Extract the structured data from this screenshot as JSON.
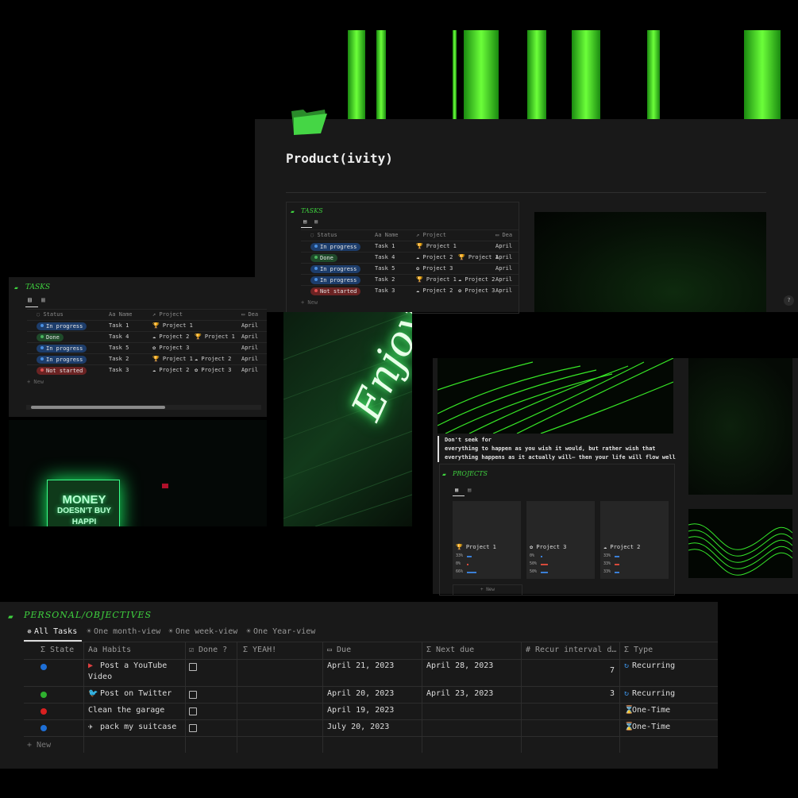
{
  "top_page": {
    "title": "Product(ivity)",
    "tasks_heading": "TASKS",
    "columns": [
      "Status",
      "Name",
      "Project",
      "Dea"
    ],
    "columns_prefix": [
      "◌",
      "Aa",
      "↗",
      "▭"
    ],
    "rows": [
      {
        "status": "In progress",
        "kind": "inprog",
        "name": "Task 1",
        "projects": [
          "🏆 Project 1"
        ],
        "date": "April"
      },
      {
        "status": "Done",
        "kind": "done",
        "name": "Task 4",
        "projects": [
          "☁ Project 2",
          "🏆 Project 1"
        ],
        "date": "April"
      },
      {
        "status": "In progress",
        "kind": "inprog",
        "name": "Task 5",
        "projects": [
          "✿ Project 3"
        ],
        "date": "April"
      },
      {
        "status": "In progress",
        "kind": "inprog",
        "name": "Task 2",
        "projects": [
          "🏆 Project 1",
          "☁ Project 2"
        ],
        "date": "April"
      },
      {
        "status": "Not started",
        "kind": "notstart",
        "name": "Task 3",
        "projects": [
          "☁ Project 2",
          "✿ Project 3"
        ],
        "date": "April"
      }
    ],
    "new_label": "+ New"
  },
  "left_page": {
    "tasks_heading": "TASKS",
    "columns": [
      "Status",
      "Name",
      "Project",
      "Dea"
    ],
    "rows": [
      {
        "status": "In progress",
        "kind": "inprog",
        "name": "Task 1",
        "projects": [
          "🏆 Project 1"
        ],
        "date": "April"
      },
      {
        "status": "Done",
        "kind": "done",
        "name": "Task 4",
        "projects": [
          "☁ Project 2",
          "🏆 Project 1"
        ],
        "date": "April"
      },
      {
        "status": "In progress",
        "kind": "inprog",
        "name": "Task 5",
        "projects": [
          "✿ Project 3"
        ],
        "date": "April"
      },
      {
        "status": "In progress",
        "kind": "inprog",
        "name": "Task 2",
        "projects": [
          "🏆 Project 1",
          "☁ Project 2"
        ],
        "date": "April"
      },
      {
        "status": "Not started",
        "kind": "notstart",
        "name": "Task 3",
        "projects": [
          "☁ Project 2",
          "✿ Project 3"
        ],
        "date": "April"
      }
    ],
    "new_label": "+ New",
    "neon_sign": [
      "MONEY",
      "DOESN'T BUY",
      "HAPPI"
    ]
  },
  "center_image": {
    "neon_text": "Enjoy"
  },
  "quote": {
    "line1": "Don't seek for",
    "line2": "everything to happen as you wish it would, but rather wish that",
    "line3": "everything happens as it actually will— then your life will flow well"
  },
  "projects": {
    "heading": "PROJECTS",
    "cards": [
      {
        "name": "🏆 Project 1",
        "stats": [
          "33%",
          "0%",
          "66%"
        ]
      },
      {
        "name": "✿ Project 3",
        "stats": [
          "0%",
          "50%",
          "50%"
        ]
      },
      {
        "name": "☁ Project 2",
        "stats": [
          "33%",
          "33%",
          "33%"
        ]
      }
    ],
    "new_label": "+ New"
  },
  "objectives": {
    "heading": "PERSONAL/OBJECTIVES",
    "tabs": [
      {
        "icon": "✵",
        "label": "All Tasks",
        "active": true
      },
      {
        "icon": "☀",
        "label": "One month-view",
        "active": false
      },
      {
        "icon": "☀",
        "label": "One week-view",
        "active": false
      },
      {
        "icon": "☀",
        "label": "One Year-view",
        "active": false
      }
    ],
    "columns": [
      "Σ State",
      "Aa Habits",
      "☑ Done ?",
      "Σ YEAH!",
      "▭ Due",
      "Σ Next due",
      "# Recur interval d…",
      "Σ Type"
    ],
    "rows": [
      {
        "state_color": "#1e6fd6",
        "habit_icon": "▶",
        "habit_icon_color": "#e04040",
        "habit": "Post a YouTube",
        "habit2": "Video",
        "due": "April 21, 2023",
        "next": "April 28, 2023",
        "interval": "7",
        "type_icon": "↻",
        "type": "Recurring"
      },
      {
        "state_color": "#2fb12f",
        "habit_icon": "🐦",
        "habit_icon_color": "#3b8fe0",
        "habit": "Post on Twitter",
        "habit2": "",
        "due": "April 20, 2023",
        "next": "April 23, 2023",
        "interval": "3",
        "type_icon": "↻",
        "type": "Recurring"
      },
      {
        "state_color": "#d92020",
        "habit_icon": "",
        "habit_icon_color": "",
        "habit": "Clean the garage",
        "habit2": "",
        "due": "April 19, 2023",
        "next": "",
        "interval": "",
        "type_icon": "⌛",
        "type": "One-Time"
      },
      {
        "state_color": "#1e6fd6",
        "habit_icon": "✈",
        "habit_icon_color": "#e6e6e6",
        "habit": "pack my suitcase",
        "habit2": "",
        "due": "July 20, 2023",
        "next": "",
        "interval": "",
        "type_icon": "⌛",
        "type": "One-Time"
      }
    ],
    "new_label": "+ New"
  },
  "help_label": "?",
  "colors": {
    "accent": "#3fd23f",
    "background": "#000000",
    "panel": "#191919"
  }
}
